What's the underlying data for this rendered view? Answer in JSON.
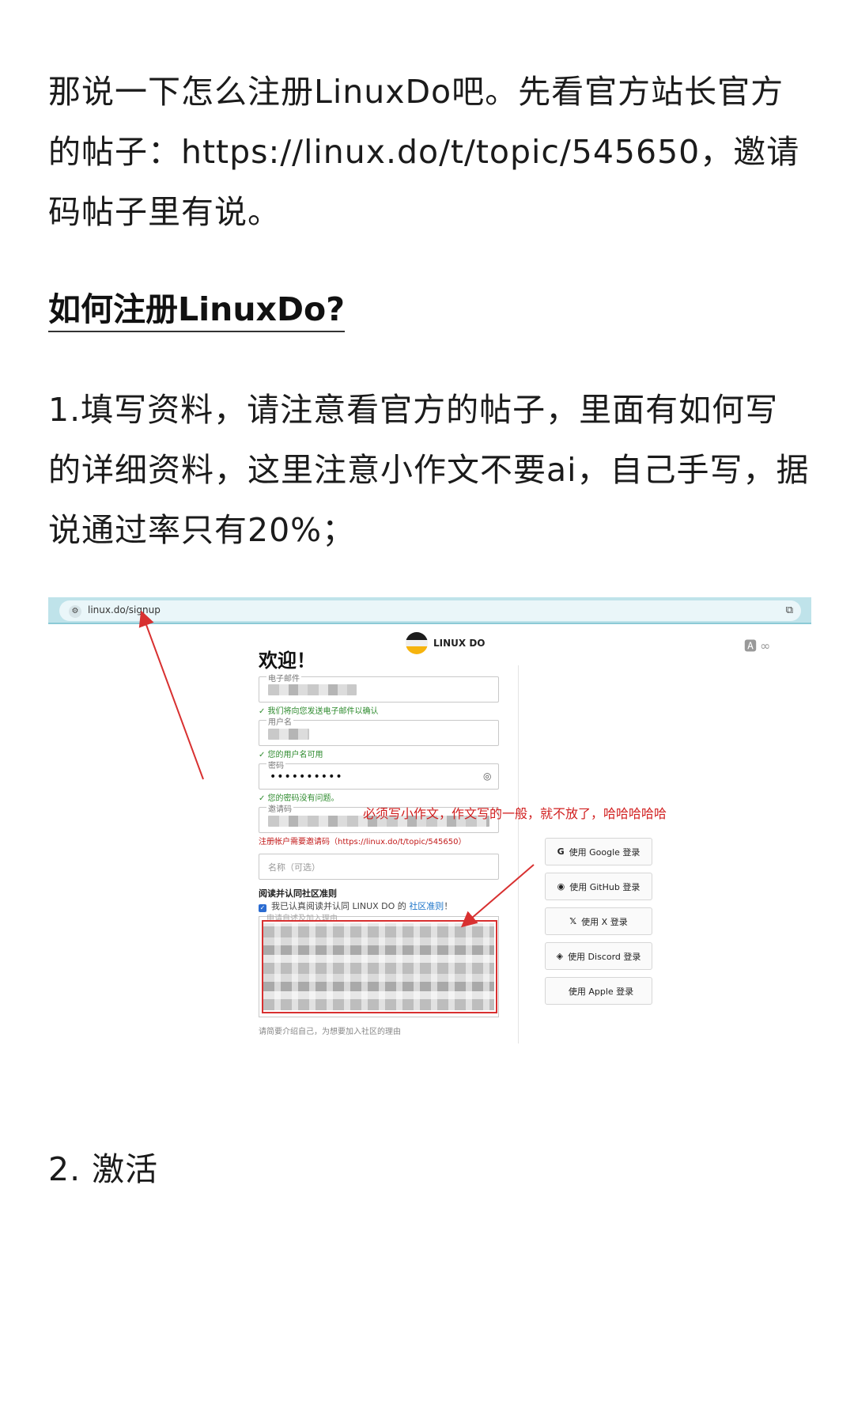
{
  "article": {
    "p1": "那说一下怎么注册LinuxDo吧。先看官方站长官方的帖子：https://linux.do/t/topic/545650，邀请码帖子里有说。",
    "heading": "如何注册LinuxDo?",
    "p2": "1.填写资料，请注意看官方的帖子，里面有如何写的详细资料，这里注意小作文不要ai，自己手写，据说通过率只有20%；",
    "p3": "2. 激活"
  },
  "screenshot": {
    "url": "linux.do/signup",
    "brand": "LINUX DO",
    "welcome": "欢迎！",
    "fields": {
      "email_label": "电子邮件",
      "email_hint": "✓ 我们将向您发送电子邮件以确认",
      "username_label": "用户名",
      "username_hint": "✓ 您的用户名可用",
      "password_label": "密码",
      "password_value": "••••••••••",
      "password_hint": "✓ 您的密码没有问题。",
      "invite_label": "邀请码",
      "invite_note": "注册帐户需要邀请码（https://linux.do/t/topic/545650）",
      "name_placeholder": "名称（可选）",
      "agree_title": "阅读并认同社区准则",
      "agree_prefix": "我已认真阅读并认同 LINUX DO 的",
      "agree_link": "社区准则",
      "agree_suffix": "！",
      "essay_label": "申请自述及加入理由",
      "below_text": "请简要介绍自己，为想要加入社区的理由"
    },
    "annotation": "必须写小作文，作文写的一般，就不放了，哈哈哈哈哈",
    "social": [
      {
        "icon": "G",
        "label": "使用 Google 登录"
      },
      {
        "icon": "◉",
        "label": "使用 GitHub 登录"
      },
      {
        "icon": "𝕏",
        "label": "使用 X 登录"
      },
      {
        "icon": "◈",
        "label": "使用 Discord 登录"
      },
      {
        "icon": "",
        "label": "使用 Apple 登录"
      }
    ]
  },
  "colors": {
    "arrow": "#d83030",
    "annotation": "#d11f1f",
    "hint_green": "#2e8b2e",
    "link_blue": "#1a73c8"
  }
}
